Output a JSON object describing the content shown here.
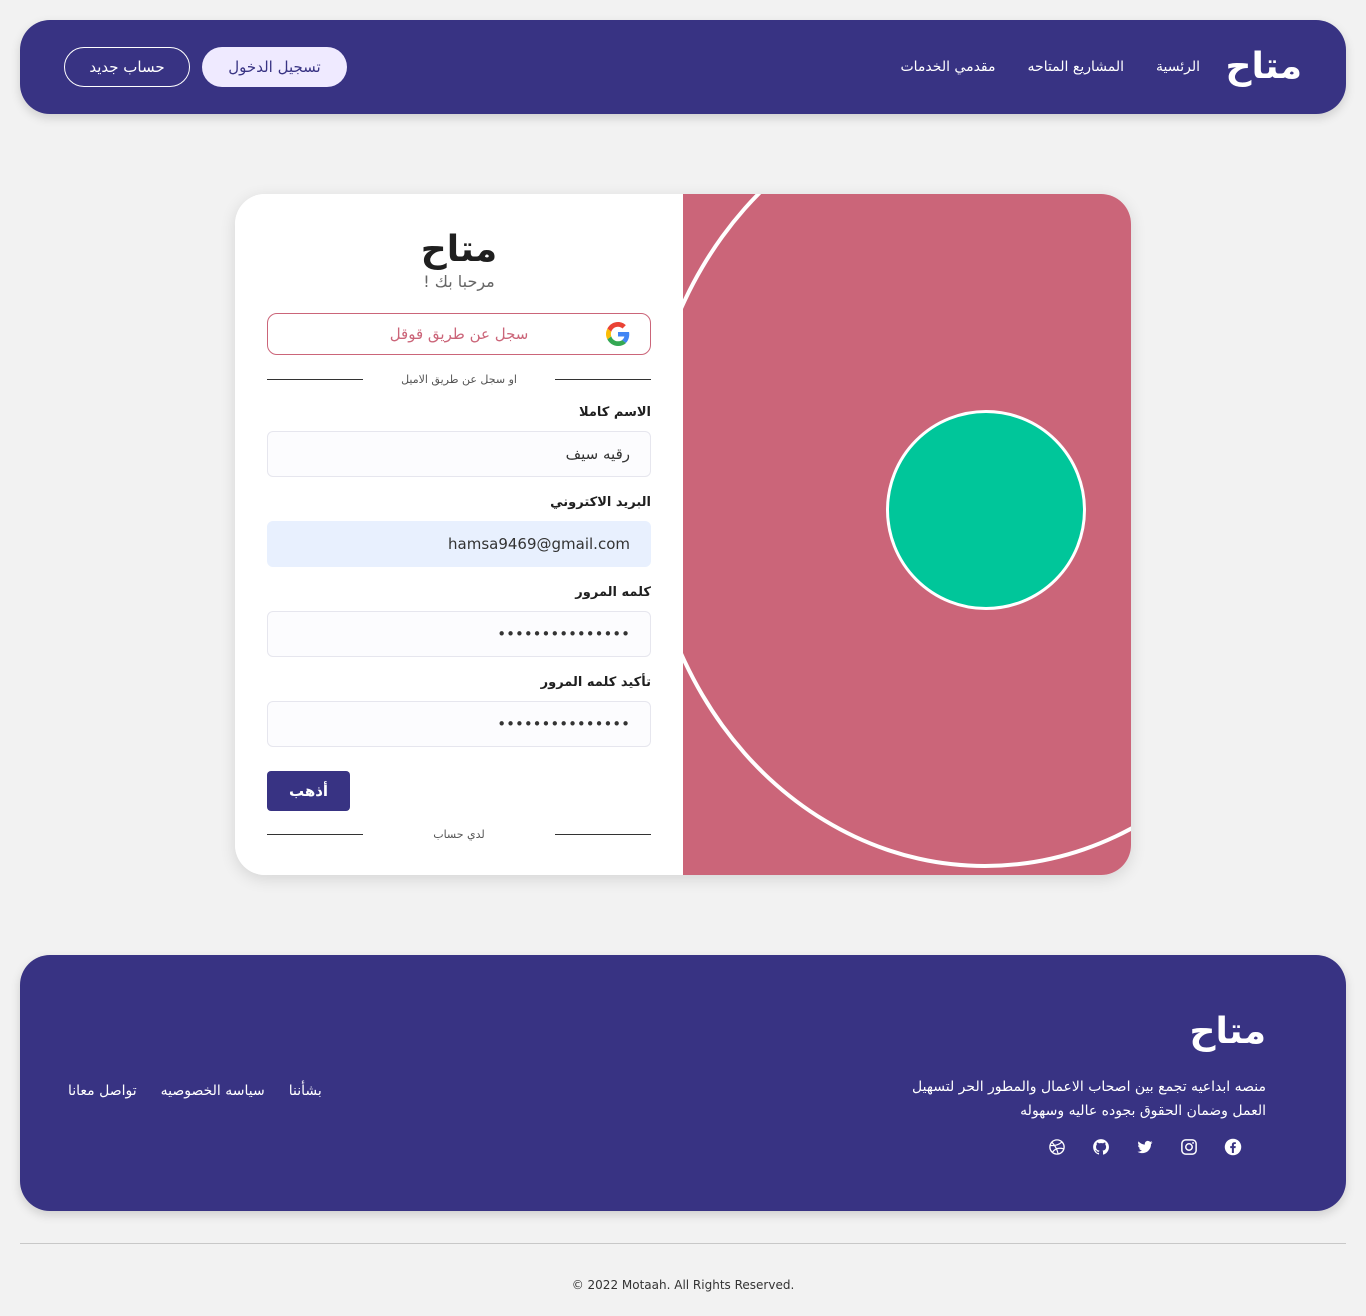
{
  "header": {
    "logo": "متاح",
    "nav": [
      "الرئسية",
      "المشاريع المتاحه",
      "مقدمي الخدمات"
    ],
    "login_label": "تسجيل الدخول",
    "signup_label": "حساب جديد"
  },
  "form": {
    "title": "متاح",
    "subtitle": "مرحبا بك !",
    "google_label": "سجل عن طريق قوقل",
    "divider_email": "او سجل عن طريق الاميل",
    "fullname_label": "الاسم كاملا",
    "fullname_value": "رقيه سيف",
    "email_label": "البريد الاكتروني",
    "email_value": "hamsa9469@gmail.com",
    "password_label": "كلمه المرور",
    "password_value": "•••••••••••••••",
    "confirm_label": "تأكيد كلمه المرور",
    "confirm_value": "•••••••••••••••",
    "submit_label": "أذهب",
    "divider_account": "لدي حساب"
  },
  "footer": {
    "logo": "متاح",
    "description": "منصه ابداعيه تجمع بين اصحاب الاعمال والمطور الحر لتسهيل العمل وضمان الحقوق بجوده عاليه وسهوله",
    "links": [
      "بشأننا",
      "سياسه الخصوصيه",
      "تواصل معانا"
    ],
    "socials": [
      "facebook-icon",
      "instagram-icon",
      "twitter-icon",
      "github-icon",
      "dribbble-icon"
    ],
    "copyright": "© 2022 Motaah. All Rights Reserved."
  },
  "colors": {
    "primary": "#383383",
    "accent": "#cb6579",
    "green": "#00c69a",
    "background": "#f2f2f2"
  }
}
